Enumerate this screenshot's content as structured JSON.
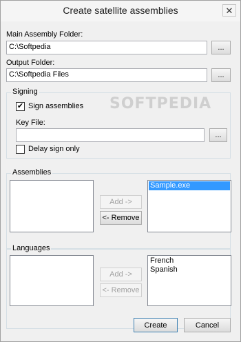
{
  "window": {
    "title": "Create satellite assemblies",
    "close_glyph": "✕"
  },
  "main_folder": {
    "label": "Main Assembly Folder:",
    "value": "C:\\Softpedia",
    "browse_label": "..."
  },
  "output_folder": {
    "label": "Output Folder:",
    "value": "C:\\Softpedia Files",
    "browse_label": "..."
  },
  "signing": {
    "group_title": "Signing",
    "sign_label": "Sign assemblies",
    "sign_checked": true,
    "key_file_label": "Key File:",
    "key_file_value": "",
    "browse_label": "...",
    "delay_label": "Delay sign only",
    "delay_checked": false
  },
  "assemblies": {
    "group_title": "Assemblies",
    "available": [],
    "selected": [
      "Sample.exe"
    ],
    "add_label": "Add ->",
    "remove_label": "<- Remove"
  },
  "languages": {
    "group_title": "Languages",
    "available": [],
    "selected": [
      "French",
      "Spanish"
    ],
    "add_label": "Add ->",
    "remove_label": "<- Remove"
  },
  "footer": {
    "create_label": "Create",
    "cancel_label": "Cancel"
  },
  "watermark": "SOFTPEDIA",
  "colors": {
    "selection": "#3399ff",
    "window_bg": "#f0f0f0"
  }
}
